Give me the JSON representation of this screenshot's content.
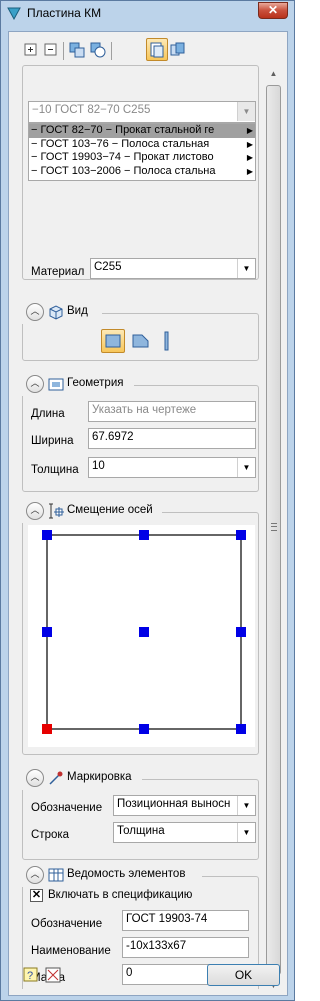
{
  "window": {
    "title": "Пластина КМ",
    "close_label": "✕"
  },
  "toolbar": {
    "icons": [
      "collapse-all-icon",
      "expand-all-icon",
      "copy-properties-icon",
      "apply-properties-icon",
      "object-properties-icon",
      "library-icon"
    ]
  },
  "spec_list": {
    "top_value": "−10 ГОСТ 82−70 С255",
    "items": [
      {
        "label": "− ГОСТ 82−70 − Прокат стальной ге",
        "selected": true
      },
      {
        "label": "− ГОСТ 103−76 − Полоса стальная",
        "selected": false
      },
      {
        "label": "− ГОСТ 19903−74 − Прокат листово",
        "selected": false
      },
      {
        "label": "− ГОСТ 103−2006 − Полоса стальна",
        "selected": false
      }
    ]
  },
  "material": {
    "label": "Материал",
    "value": "С255"
  },
  "view_group": {
    "title": "Вид",
    "icons": [
      "plate-view-icon",
      "profile-view-icon",
      "edge-view-icon"
    ]
  },
  "geometry_group": {
    "title": "Геометрия",
    "length_label": "Длина",
    "length_placeholder": "Указать на чертеже",
    "width_label": "Ширина",
    "width_value": "67.6972",
    "thickness_label": "Толщина",
    "thickness_value": "10"
  },
  "axis_group": {
    "title": "Смещение осей"
  },
  "marking_group": {
    "title": "Маркировка",
    "designation_label": "Обозначение",
    "designation_value": "Позиционная выносн",
    "line_label": "Строка",
    "line_value": "Толщина"
  },
  "bill_group": {
    "title": "Ведомость элементов",
    "include_label": "Включать в спецификацию",
    "include_checked": true,
    "designation_label": "Обозначение",
    "designation_value": "ГОСТ 19903-74",
    "name_label": "Наименование",
    "name_value": "-10x133x67",
    "mass_label": "Масса",
    "mass_value": "0"
  },
  "footer": {
    "ok_label": "OK",
    "icons": [
      "help-icon",
      "settings-icon"
    ]
  },
  "colors": {
    "handle": "#0000e6",
    "handle_origin": "#e60000",
    "selection": "#a0a0a0"
  }
}
